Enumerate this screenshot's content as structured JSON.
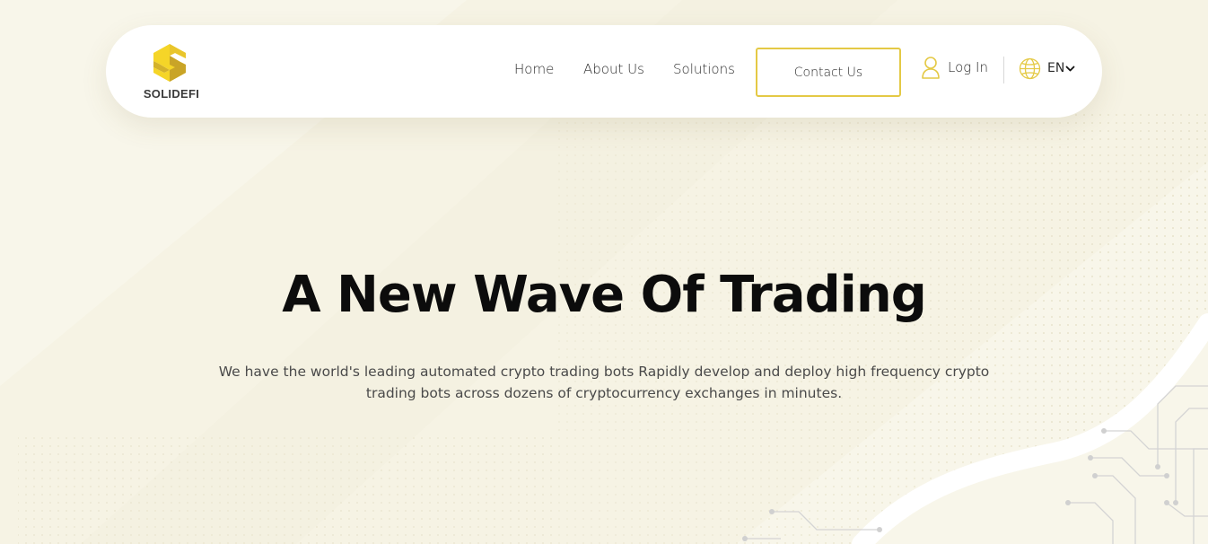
{
  "brand": {
    "name": "SOLIDEFI",
    "logo_icon": "hexagon-s-logo-icon",
    "accent_color": "#e4c945"
  },
  "nav": {
    "links": [
      "Home",
      "About Us",
      "Solutions"
    ],
    "contact_label": "Contact Us",
    "login_label": "Log In",
    "login_icon": "user-icon",
    "language": "EN",
    "language_icon": "globe-icon"
  },
  "hero": {
    "title": "A New Wave Of Trading",
    "description": "We have the world's leading automated crypto trading bots Rapidly develop and deploy high frequency crypto trading bots across dozens of cryptocurrency exchanges in minutes."
  },
  "colors": {
    "background": "#f8f6ea",
    "accent": "#e4c945",
    "title": "#0c0c0c",
    "body_text": "#4a4a4a"
  }
}
